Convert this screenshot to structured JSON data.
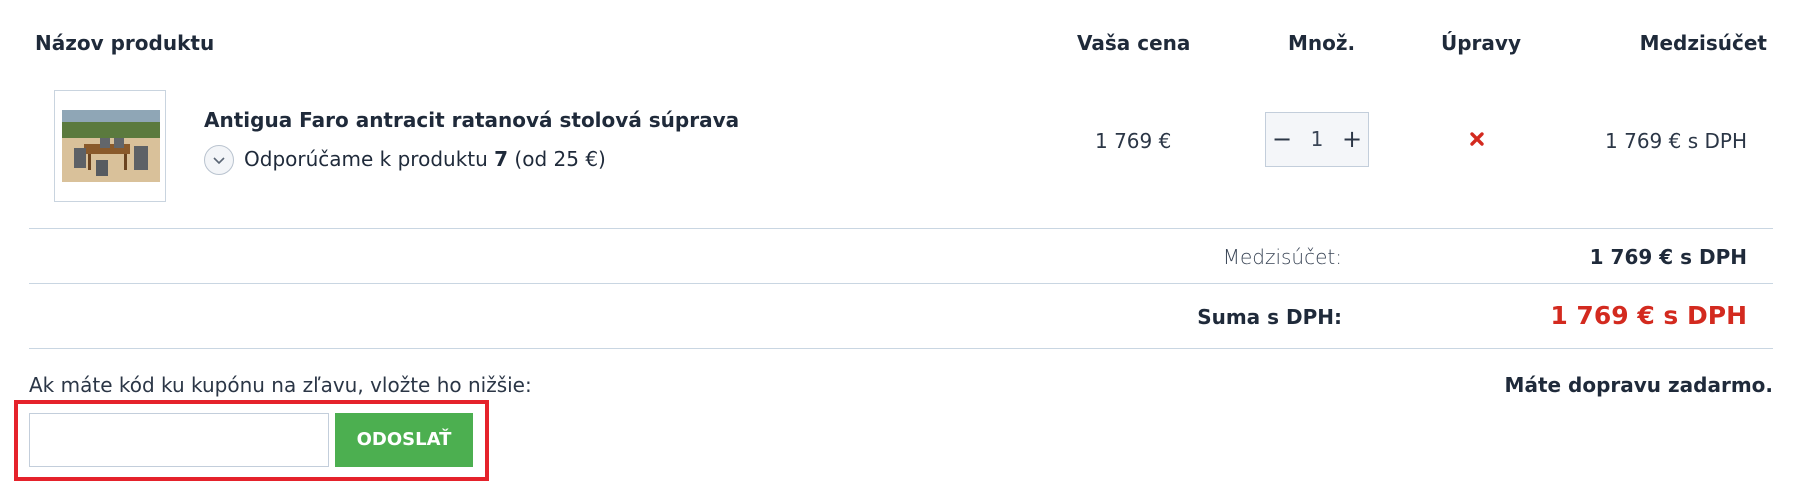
{
  "table": {
    "headers": {
      "product": "Názov produktu",
      "price": "Vaša cena",
      "qty": "Množ.",
      "actions": "Úpravy",
      "subtotal": "Medzisúčet"
    },
    "item": {
      "name": "Antigua Faro antracit ratanová stolová súprava",
      "rec_prefix": "Odporúčame k produktu ",
      "rec_count": "7",
      "rec_suffix": " (od 25 €)",
      "price": "1 769 €",
      "quantity": "1",
      "subtotal": "1 769 € s DPH",
      "remove_icon": "close-icon",
      "colors": {
        "remove": "#d32a1f"
      }
    }
  },
  "summary": {
    "subtotal_label": "Medzisúčet:",
    "subtotal_value": "1 769 € s DPH",
    "total_label": "Suma s DPH:",
    "total_value": "1 769 € s DPH",
    "colors": {
      "total": "#d32a1f"
    }
  },
  "coupon": {
    "prompt": "Ak máte kód ku kupónu na zľavu, vložte ho nižšie:",
    "input_value": "",
    "button_label": "ODOSLAŤ",
    "colors": {
      "button": "#4caf50",
      "highlight": "#e5222b"
    }
  },
  "shipping": {
    "note": "Máte dopravu zadarmo."
  }
}
